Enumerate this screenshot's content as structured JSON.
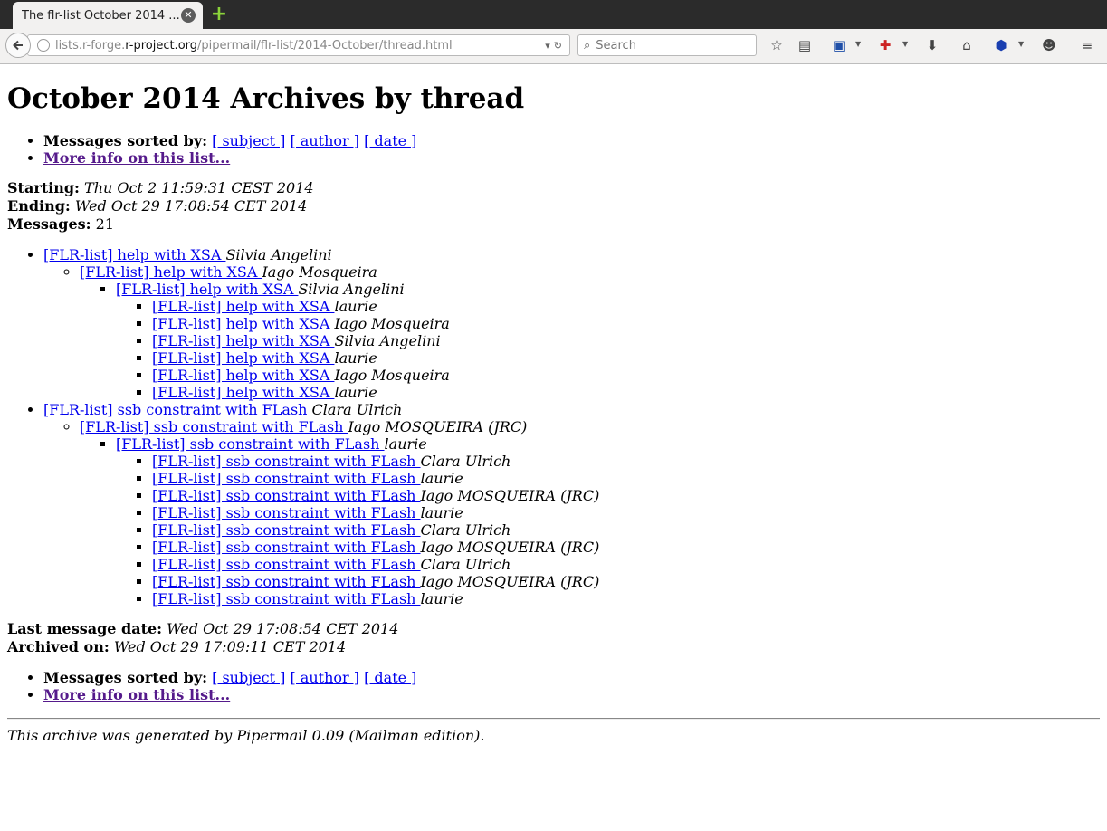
{
  "browser": {
    "tab_title": "The flr-list October 2014 ...",
    "tab_close": "✕",
    "new_tab": "+",
    "url_prefix": "lists.r-forge.",
    "url_domain": "r-project.org",
    "url_path": "/pipermail/flr-list/2014-October/thread.html",
    "search_placeholder": "Search"
  },
  "page": {
    "title": "October 2014 Archives by thread",
    "sort_label": "Messages sorted by:",
    "sort_subject": "[ subject ]",
    "sort_author": "[ author ]",
    "sort_date": "[ date ]",
    "more_info": "More info on this list...",
    "starting_label": "Starting:",
    "starting_value": "Thu Oct 2 11:59:31 CEST 2014",
    "ending_label": "Ending:",
    "ending_value": "Wed Oct 29 17:08:54 CET 2014",
    "messages_label": "Messages:",
    "messages_value": "21",
    "last_date_label": "Last message date:",
    "last_date_value": "Wed Oct 29 17:08:54 CET 2014",
    "archived_label": "Archived on:",
    "archived_value": "Wed Oct 29 17:09:11 CET 2014",
    "footer": "This archive was generated by Pipermail 0.09 (Mailman edition)."
  },
  "threads": [
    {
      "subject": "[FLR-list] help with XSA ",
      "author": "Silvia Angelini",
      "reply": {
        "subject": "[FLR-list] help with XSA ",
        "author": "Iago Mosqueira",
        "reply": {
          "subject": "[FLR-list] help with XSA ",
          "author": "Silvia Angelini",
          "replies": [
            {
              "subject": "[FLR-list] help with XSA ",
              "author": "laurie"
            },
            {
              "subject": "[FLR-list] help with XSA ",
              "author": "Iago Mosqueira"
            },
            {
              "subject": "[FLR-list] help with XSA ",
              "author": "Silvia Angelini"
            },
            {
              "subject": "[FLR-list] help with XSA ",
              "author": "laurie"
            },
            {
              "subject": "[FLR-list] help with XSA ",
              "author": "Iago Mosqueira"
            },
            {
              "subject": "[FLR-list] help with XSA ",
              "author": "laurie"
            }
          ]
        }
      }
    },
    {
      "subject": "[FLR-list] ssb constraint with FLash ",
      "author": "Clara Ulrich",
      "reply": {
        "subject": "[FLR-list] ssb constraint with FLash ",
        "author": "Iago MOSQUEIRA (JRC)",
        "reply": {
          "subject": "[FLR-list] ssb constraint with FLash ",
          "author": "laurie",
          "replies": [
            {
              "subject": "[FLR-list] ssb constraint with FLash ",
              "author": "Clara Ulrich"
            },
            {
              "subject": "[FLR-list] ssb constraint with FLash ",
              "author": "laurie"
            },
            {
              "subject": "[FLR-list] ssb constraint with FLash ",
              "author": "Iago MOSQUEIRA (JRC)"
            },
            {
              "subject": "[FLR-list] ssb constraint with FLash ",
              "author": "laurie"
            },
            {
              "subject": "[FLR-list] ssb constraint with FLash ",
              "author": "Clara Ulrich"
            },
            {
              "subject": "[FLR-list] ssb constraint with FLash ",
              "author": "Iago MOSQUEIRA (JRC)"
            },
            {
              "subject": "[FLR-list] ssb constraint with FLash ",
              "author": "Clara Ulrich"
            },
            {
              "subject": "[FLR-list] ssb constraint with FLash ",
              "author": "Iago MOSQUEIRA (JRC)"
            },
            {
              "subject": "[FLR-list] ssb constraint with FLash ",
              "author": "laurie"
            }
          ]
        }
      }
    }
  ]
}
